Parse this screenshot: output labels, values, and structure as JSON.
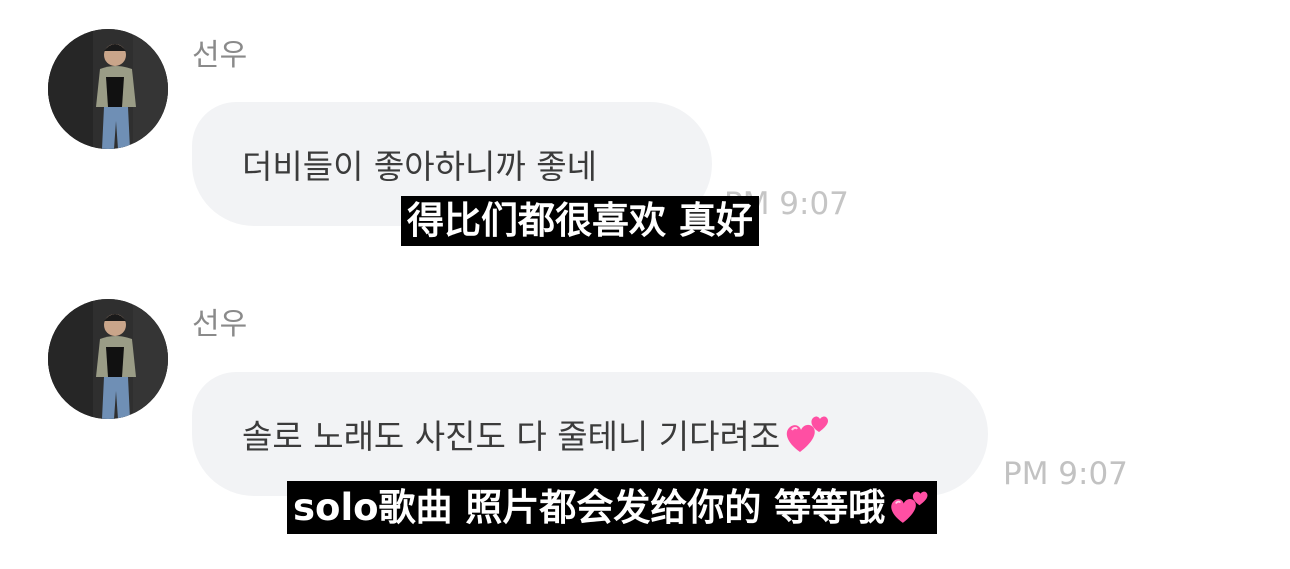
{
  "messages": [
    {
      "sender": "선우",
      "text": "더비들이 좋아하니까 좋네",
      "time": "PM 9:07",
      "subtitle": "得比们都很喜欢 真好",
      "subtitle_icon": null
    },
    {
      "sender": "선우",
      "text": "솔로 노래도 사진도 다 줄테니 기다려조",
      "text_icon": "two-hearts-icon",
      "time": "PM 9:07",
      "subtitle": "solo歌曲 照片都会发给你的 等等哦",
      "subtitle_icon": "two-hearts-icon"
    }
  ],
  "colors": {
    "bubble": "#f2f3f5",
    "message_text": "#3b3b3b",
    "sender": "#8a8a8a",
    "time": "#c5c5c5",
    "subtitle_bg": "#000000",
    "subtitle_text": "#ffffff",
    "heart": "#ff4fa3"
  }
}
